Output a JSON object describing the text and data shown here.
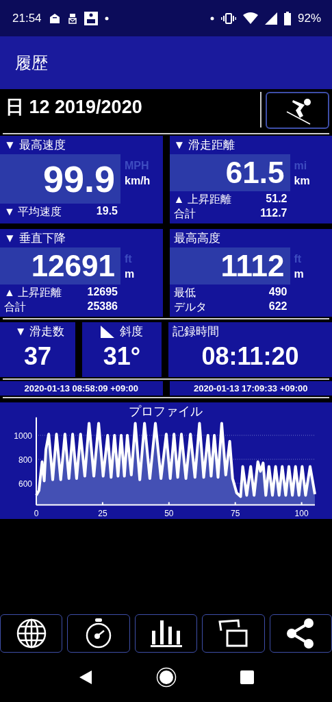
{
  "status_bar": {
    "time": "21:54",
    "battery": "92%"
  },
  "app_bar": {
    "title": "履歴"
  },
  "header": {
    "title": "日 12 2019/2020"
  },
  "big_stats": [
    {
      "label": "▼ 最高速度",
      "value": "99.9",
      "units": [
        {
          "label": "MPH",
          "selected": false
        },
        {
          "label": "km/h",
          "selected": true
        }
      ],
      "rows": [
        {
          "label": "▼ 平均速度",
          "value": "19.5"
        }
      ]
    },
    {
      "label": "▼ 滑走距離",
      "value": "61.5",
      "units": [
        {
          "label": "mi",
          "selected": false
        },
        {
          "label": "km",
          "selected": true
        }
      ],
      "rows": [
        {
          "label": "▲ 上昇距離",
          "value": "51.2"
        },
        {
          "label": "合計",
          "value": "112.7"
        }
      ]
    },
    {
      "label": "▼ 垂直下降",
      "value": "12691",
      "units": [
        {
          "label": "ft",
          "selected": false
        },
        {
          "label": "m",
          "selected": true
        }
      ],
      "rows": [
        {
          "label": "▲ 上昇距離",
          "value": "12695"
        },
        {
          "label": "合計",
          "value": "25386"
        }
      ]
    },
    {
      "label": "最高高度",
      "value": "1112",
      "units": [
        {
          "label": "ft",
          "selected": false
        },
        {
          "label": "m",
          "selected": true
        }
      ],
      "rows": [
        {
          "label": "最低",
          "value": "490"
        },
        {
          "label": "デルタ",
          "value": "622"
        }
      ]
    }
  ],
  "small_stats": [
    {
      "kind": "runs",
      "label": "▼ 滑走数",
      "value": "37"
    },
    {
      "kind": "slope",
      "label": "斜度",
      "value": "31°"
    },
    {
      "kind": "time",
      "label": "記録時間",
      "value": "08:11:20"
    }
  ],
  "timestamps": [
    "2020-01-13 08:58:09 +09:00",
    "2020-01-13 17:09:33 +09:00"
  ],
  "profile": {
    "chart_data": {
      "type": "area",
      "title": "プロファイル",
      "xlim": [
        0,
        105
      ],
      "ylim": [
        420,
        1150
      ],
      "grid": true,
      "xticks": [
        0,
        25,
        50,
        75,
        100
      ],
      "yticks": [
        600,
        800,
        1000
      ],
      "x": [
        0,
        1,
        2.2,
        3,
        3.6,
        4.7,
        6.2,
        7.6,
        9.2,
        10.8,
        12.3,
        13.7,
        15.2,
        16.7,
        18.3,
        19.9,
        21.7,
        23.5,
        25.2,
        26.9,
        28.2,
        29.5,
        30.8,
        32,
        33.2,
        34.3,
        35.8,
        37.3,
        39,
        40.8,
        42.8,
        44.9,
        47,
        49,
        50.5,
        51.9,
        53.3,
        54.7,
        56.4,
        58.1,
        59.8,
        61.5,
        63.1,
        64.7,
        65.9,
        67.1,
        68.5,
        69.9,
        71.4,
        72.9,
        74,
        75.5,
        77,
        77.8,
        79.3,
        80.8,
        82.1,
        83.5,
        84.5,
        85.5,
        86.5,
        87.7,
        89,
        90.2,
        91.5,
        92.7,
        94,
        95.2,
        96.5,
        97.7,
        99,
        100.2,
        101.5,
        103.2,
        105
      ],
      "series": [
        {
          "color": "#ffffff",
          "values": [
            500,
            540,
            780,
            620,
            880,
            1010,
            630,
            1010,
            630,
            1010,
            640,
            1010,
            640,
            1010,
            660,
            1100,
            660,
            1100,
            660,
            1000,
            650,
            1000,
            660,
            1000,
            660,
            1000,
            670,
            1100,
            630,
            1100,
            640,
            1100,
            640,
            1010,
            640,
            1010,
            650,
            1010,
            640,
            1010,
            650,
            1100,
            650,
            1000,
            660,
            1000,
            650,
            1100,
            670,
            950,
            640,
            520,
            490,
            740,
            500,
            740,
            500,
            780,
            700,
            770,
            500,
            740,
            500,
            740,
            500,
            740,
            500,
            740,
            500,
            740,
            500,
            740,
            500,
            740,
            510
          ]
        }
      ]
    }
  },
  "toolbar": [
    {
      "kind": "globe"
    },
    {
      "kind": "stopwatch"
    },
    {
      "kind": "chart"
    },
    {
      "kind": "cards"
    },
    {
      "kind": "share"
    }
  ]
}
